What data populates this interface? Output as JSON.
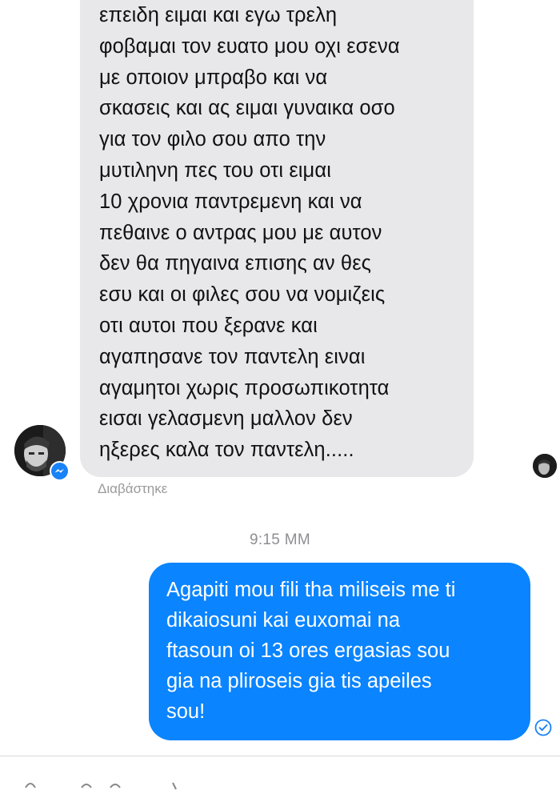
{
  "conversation": {
    "incoming_message": {
      "lines": [
        "επειδη ειμαι και εγω τρελη",
        "φοβαμαι τον ευατο μου οχι εσενα",
        "με οποιον μπραβο και να",
        "σκασεις και ας ειμαι γυναικα οσο",
        "για τον φιλο σου απο την",
        "μυτιληνη πες του οτι ειμαι",
        " 10 χρονια παντρεμενη και να",
        "πεθαινε ο αντρας μου με αυτον",
        "δεν θα πηγαινα επισης αν θες",
        "εσυ και οι φιλες σου να νομιζεις",
        "οτι αυτοι που ξερανε και",
        "αγαπησανε τον παντελη ειναι",
        "αγαμητοι χωρις προσωπικοτητα",
        "εισαι γελασμενη μαλλον δεν",
        "ηξερες καλα τον παντελη....."
      ],
      "read_receipt": "Διαβάστηκε"
    },
    "timestamp": "9:15 ΜΜ",
    "outgoing_message": {
      "lines": [
        "Agapiti mou fili tha miliseis me ti",
        "dikaiosuni kai euxomai na",
        "ftasoun oi 13 ores ergasias sou",
        "gia na pliroseis gia tis apeiles",
        "sou!"
      ]
    }
  },
  "icons": {
    "messenger_badge": "messenger-badge-icon",
    "delivered": "delivered-check-icon"
  },
  "colors": {
    "incoming_bubble": "#e8e7ea",
    "outgoing_bubble": "#0a84ff",
    "accent": "#1a82f7",
    "meta_text": "#8e8e93"
  }
}
